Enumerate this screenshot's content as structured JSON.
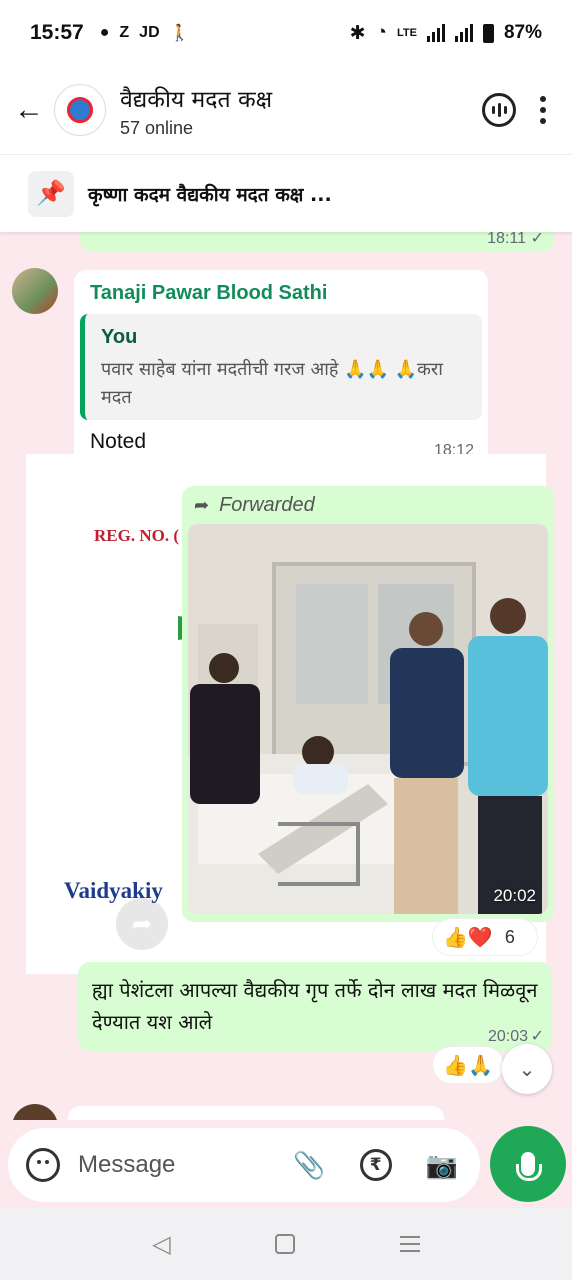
{
  "status_bar": {
    "time": "15:57",
    "left_icons": [
      "chat-bubble-icon",
      "Z",
      "JD",
      "walking-icon"
    ],
    "battery": "87%",
    "network_label": "LTE"
  },
  "header": {
    "title": "वैद्यकीय मदत कक्ष",
    "subtitle": "57 online"
  },
  "pinned": {
    "text": "कृष्णा कदम वैद्यकीय मदत कक्ष ..."
  },
  "messages": {
    "top_partial": {
      "time": "18:11"
    },
    "tanaji": {
      "sender": "Tanaji Pawar Blood Sathi",
      "quote_name": "You",
      "quote_text": "पवार साहेब यांना मदतीची गरज आहे 🙏🙏 🙏करा मदत",
      "body": "Noted",
      "time": "18:12"
    },
    "background_card": {
      "reg_text": "REG. NO. (",
      "brand_text": "Vaidyakiy"
    },
    "forwarded_image": {
      "label": "Forwarded",
      "time": "20:02",
      "reactions": "👍❤️",
      "reaction_count": "6"
    },
    "outgoing": {
      "body": "ह्या पेशंटला आपल्या वैद्यकीय गृप तर्फे दोन लाख मदत मिळवून देण्यात यश आले",
      "time": "20:03",
      "reactions": "👍🙏"
    }
  },
  "composer": {
    "placeholder": "Message"
  },
  "colors": {
    "accent_green": "#1fa855",
    "outgoing_bubble": "#d9fdd3",
    "chat_background": "#fbe9ee",
    "sender_name": "#128c5c"
  }
}
